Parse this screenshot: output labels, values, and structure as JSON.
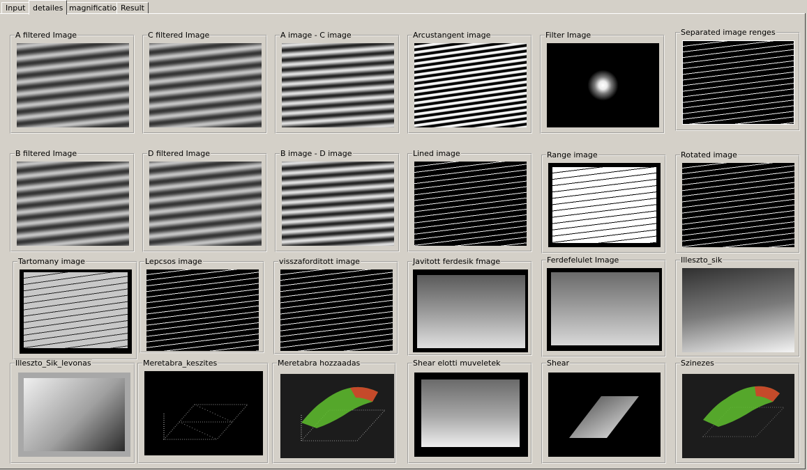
{
  "tabs": [
    {
      "label": "Input",
      "active": false
    },
    {
      "label": "detailes",
      "active": true
    },
    {
      "label": "magnification",
      "active": false
    },
    {
      "label": "Result",
      "active": false
    }
  ],
  "panels": {
    "a_filtered": "A filtered Image",
    "c_filtered": "C filtered Image",
    "a_minus_c": "A image - C image",
    "arcustangent": "Arcustangent image",
    "filter": "Filter Image",
    "separated": "Separated  image renges",
    "b_filtered": "B filtered Image",
    "d_filtered": "D filtered Image",
    "b_minus_d": "B image - D image",
    "lined": "Lined image",
    "range": "Range image",
    "rotated": "Rotated image",
    "tartomany": "Tartomany image",
    "lepcsos": "Lepcsos     image",
    "visszaforditott": "visszaforditott  image",
    "javitott": "Javitott ferdesik fmage",
    "ferdefelulet": "Ferdefelulet Image",
    "illeszto_sik": "Illeszto_sik",
    "illeszto_sik_levonas": "Illeszto_Sik_levonas",
    "meretabra_keszites": "Meretabra_keszites",
    "meretabra_hozzaadas": "Meretabra hozzaadas",
    "shear_elotti": "Shear elotti muveletek",
    "shear": "Shear",
    "szinezes": "Szinezes"
  },
  "colors": {
    "window_bg": "#d4d0c8",
    "surface_green": "#5fbf2e",
    "surface_red": "#d2402a"
  }
}
